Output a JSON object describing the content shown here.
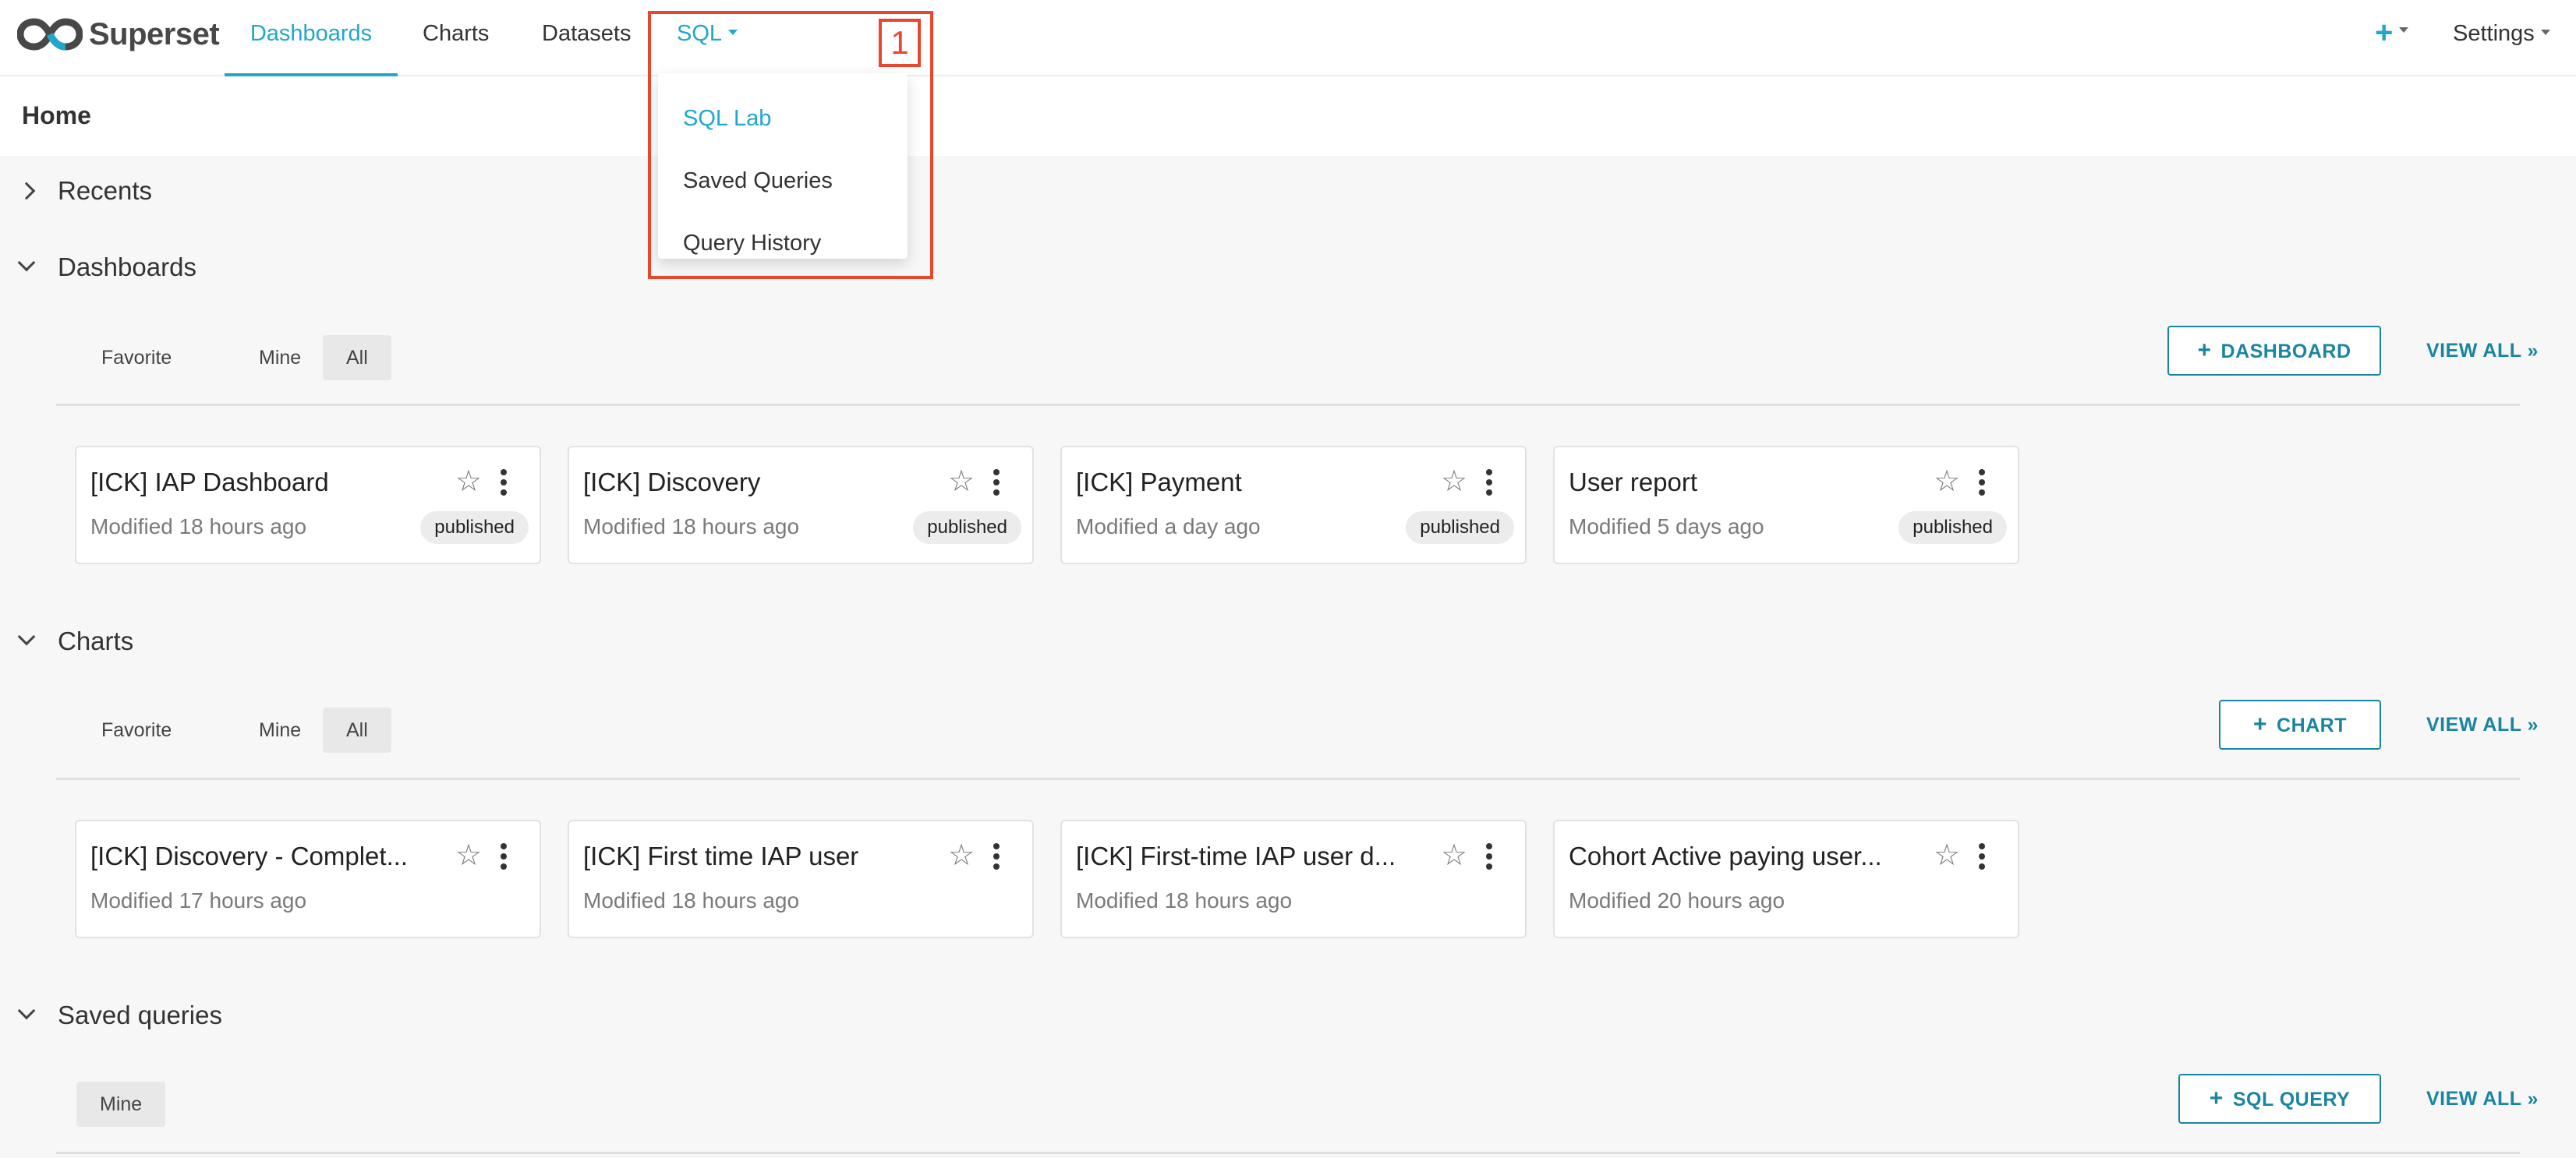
{
  "nav": {
    "logo_text": "Superset",
    "items": [
      "Dashboards",
      "Charts",
      "Datasets",
      "SQL"
    ],
    "plus_icon": "plus-icon",
    "settings": "Settings"
  },
  "sql_menu": {
    "items": [
      "SQL Lab",
      "Saved Queries",
      "Query History"
    ],
    "marker": "1"
  },
  "page": {
    "title": "Home"
  },
  "recents": {
    "title": "Recents"
  },
  "dashboards": {
    "title": "Dashboards",
    "tabs": [
      "Favorite",
      "Mine",
      "All"
    ],
    "add_label": "DASHBOARD",
    "view_all": "VIEW ALL »",
    "cards": [
      {
        "title": "[ICK] IAP Dashboard",
        "modified": "Modified 18 hours ago",
        "status": "published"
      },
      {
        "title": "[ICK] Discovery",
        "modified": "Modified 18 hours ago",
        "status": "published"
      },
      {
        "title": "[ICK] Payment",
        "modified": "Modified a day ago",
        "status": "published"
      },
      {
        "title": "User report",
        "modified": "Modified 5 days ago",
        "status": "published"
      }
    ]
  },
  "charts": {
    "title": "Charts",
    "tabs": [
      "Favorite",
      "Mine",
      "All"
    ],
    "add_label": "CHART",
    "view_all": "VIEW ALL »",
    "cards": [
      {
        "title": "[ICK] Discovery - Complet...",
        "modified": "Modified 17 hours ago"
      },
      {
        "title": "[ICK] First time IAP user",
        "modified": "Modified 18 hours ago"
      },
      {
        "title": "[ICK] First-time IAP user d...",
        "modified": "Modified 18 hours ago"
      },
      {
        "title": "Cohort Active paying user...",
        "modified": "Modified 20 hours ago"
      }
    ]
  },
  "saved_queries": {
    "title": "Saved queries",
    "tabs": [
      "Mine"
    ],
    "add_label": "SQL QUERY",
    "view_all": "VIEW ALL »"
  },
  "colors": {
    "accent": "#20a7c9",
    "button": "#1a85a0",
    "highlight": "#e8472d"
  }
}
